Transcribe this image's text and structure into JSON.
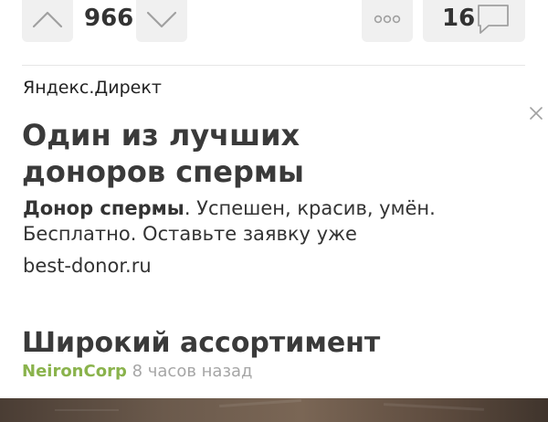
{
  "actions": {
    "score": "966",
    "comments_count": "16"
  },
  "ad": {
    "source": "Яндекс.Директ",
    "title": "Один из лучших доноров спермы",
    "text_bold": "Донор спермы",
    "text_rest": ". Успешен, красив, умён. Бесплатно. Оставьте заявку уже",
    "domain": "best-donor.ru"
  },
  "post": {
    "title": "Широкий ассортимент",
    "author": "NeironCorp",
    "time": "8 часов назад"
  },
  "icons": {
    "vote_up": "chevron-up-icon",
    "vote_down": "chevron-down-icon",
    "more": "more-dots-icon",
    "comments": "comment-bubble-icon",
    "close": "close-icon"
  },
  "colors": {
    "button_bg": "#f0f0f0",
    "author": "#8ab34c",
    "time": "#a6a6a6",
    "icon": "#a0a0a0"
  }
}
